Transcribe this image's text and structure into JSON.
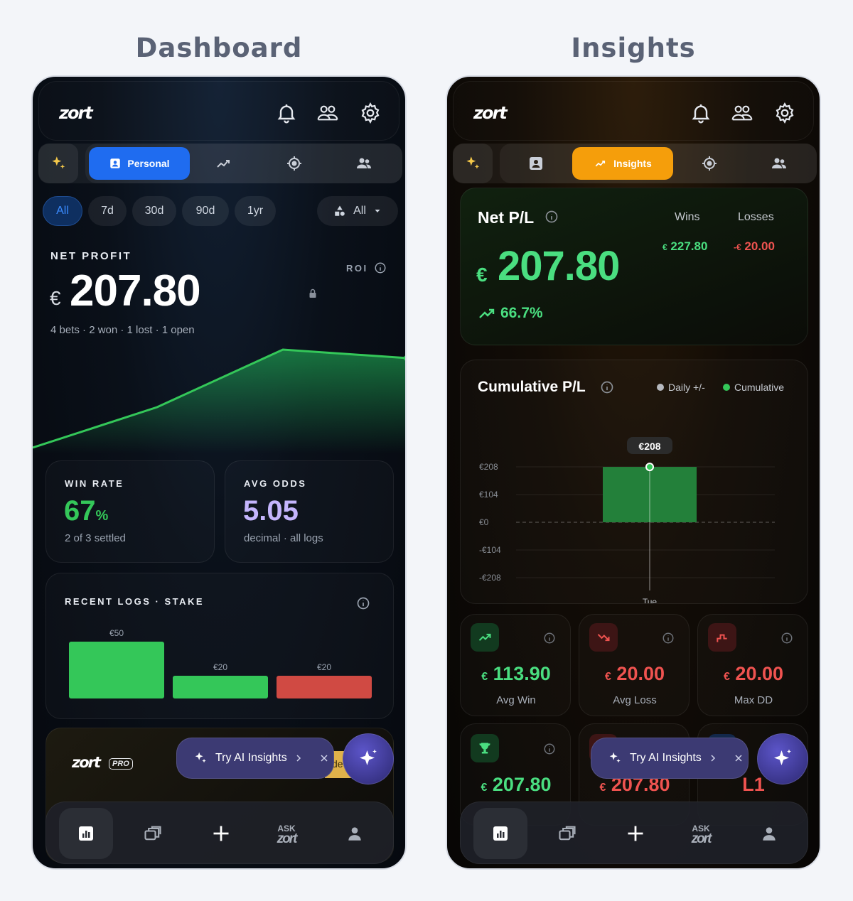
{
  "titles": {
    "dashboard": "Dashboard",
    "insights": "Insights"
  },
  "app": {
    "logo": "zort"
  },
  "dashboard": {
    "tabs": {
      "personal_label": "Personal"
    },
    "ranges": [
      "All",
      "7d",
      "30d",
      "90d",
      "1yr"
    ],
    "filter_label": "All",
    "net_profit": {
      "label": "NET PROFIT",
      "currency": "€",
      "value": "207.80",
      "roi_label": "ROI",
      "summary": "4 bets · 2 won · 1 lost · 1 open"
    },
    "win_rate": {
      "label": "WIN RATE",
      "value": "67",
      "unit": "%",
      "sub": "2 of 3 settled"
    },
    "avg_odds": {
      "label": "AVG ODDS",
      "value": "5.05",
      "sub": "decimal · all logs"
    },
    "recent_logs": {
      "label": "RECENT LOGS · STAKE",
      "bars": [
        {
          "label": "€50",
          "value": 50,
          "result": "won"
        },
        {
          "label": "€20",
          "value": 20,
          "result": "won"
        },
        {
          "label": "€20",
          "value": 20,
          "result": "lost"
        }
      ]
    },
    "profit_trend": [
      0,
      55,
      207.8,
      198
    ],
    "pro": {
      "logo": "zort",
      "badge": "PRO",
      "cta_fragment": "de"
    },
    "ai_pill": "Try AI Insights"
  },
  "insights": {
    "tabs": {
      "insights_label": "Insights"
    },
    "net_pl": {
      "title": "Net P/L",
      "currency": "€",
      "value": "207.80",
      "change": "66.7%",
      "wins_label": "Wins",
      "losses_label": "Losses",
      "wins_value": "227.80",
      "wins_currency": "€",
      "losses_value": "20.00",
      "losses_currency": "-€"
    },
    "cumulative": {
      "title": "Cumulative P/L",
      "legend_daily": "Daily +/-",
      "legend_cumulative": "Cumulative",
      "tooltip": "€208"
    },
    "chart_data": {
      "type": "bar",
      "categories": [
        "Tue"
      ],
      "series": [
        {
          "name": "Daily +/-",
          "values": [
            207.8
          ]
        },
        {
          "name": "Cumulative",
          "values": [
            207.8
          ]
        }
      ],
      "yticks": [
        "€208",
        "€104",
        "€0",
        "-€104",
        "-€208"
      ],
      "ylim": [
        -208,
        208
      ]
    },
    "stats": [
      {
        "currency": "€",
        "value": "113.90",
        "label": "Avg Win",
        "tone": "green"
      },
      {
        "currency": "€",
        "value": "20.00",
        "label": "Avg Loss",
        "tone": "red"
      },
      {
        "currency": "€",
        "value": "20.00",
        "label": "Max DD",
        "tone": "red"
      }
    ],
    "stats2": [
      {
        "currency": "€",
        "value": "207.80",
        "tone": "green"
      },
      {
        "currency": "€",
        "value": "207.80",
        "tone": "red"
      },
      {
        "value": "L1",
        "tone": "red"
      }
    ],
    "ai_pill": "Try AI Insights",
    "nav_ask": "ASK"
  },
  "nav": {
    "ask": "ASK"
  }
}
